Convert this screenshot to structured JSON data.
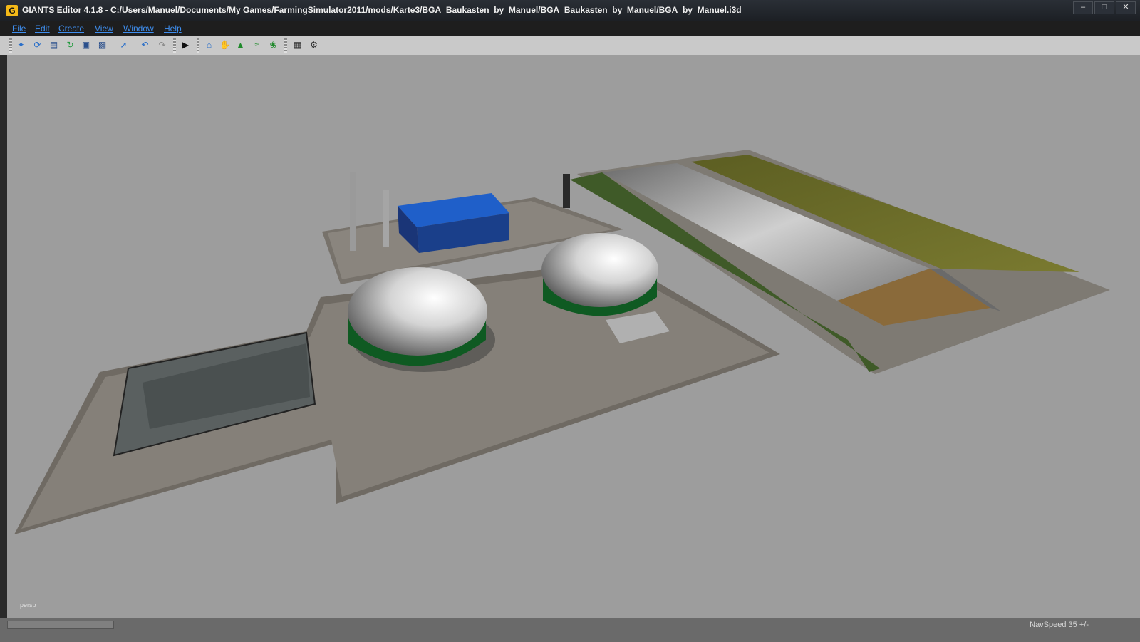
{
  "window": {
    "app_icon": "G",
    "title": "GIANTS Editor 4.1.8 - C:/Users/Manuel/Documents/My Games/FarmingSimulator2011/mods/Karte3/BGA_Baukasten_by_Manuel/BGA_Baukasten_by_Manuel/BGA_by_Manuel.i3d",
    "controls": [
      "minimize-icon",
      "maximize-icon",
      "close-icon"
    ]
  },
  "menu": [
    "File",
    "Edit",
    "Create",
    "View",
    "Window",
    "Help"
  ],
  "toolbar": {
    "icons": [
      "new-icon",
      "open-icon",
      "document-icon",
      "refresh-icon",
      "save-icon",
      "save-as-icon",
      "import-icon",
      "undo-icon",
      "redo-icon",
      "play-icon",
      "home-icon",
      "grab-icon",
      "terrain-up-icon",
      "terrain-smooth-icon",
      "paint-foliage-icon",
      "grid-icon",
      "settings-icon"
    ]
  },
  "viewport": {
    "camera": "persp",
    "background": "#9d9d9d"
  },
  "status": {
    "nav_speed": "NavSpeed 35 +/-"
  }
}
